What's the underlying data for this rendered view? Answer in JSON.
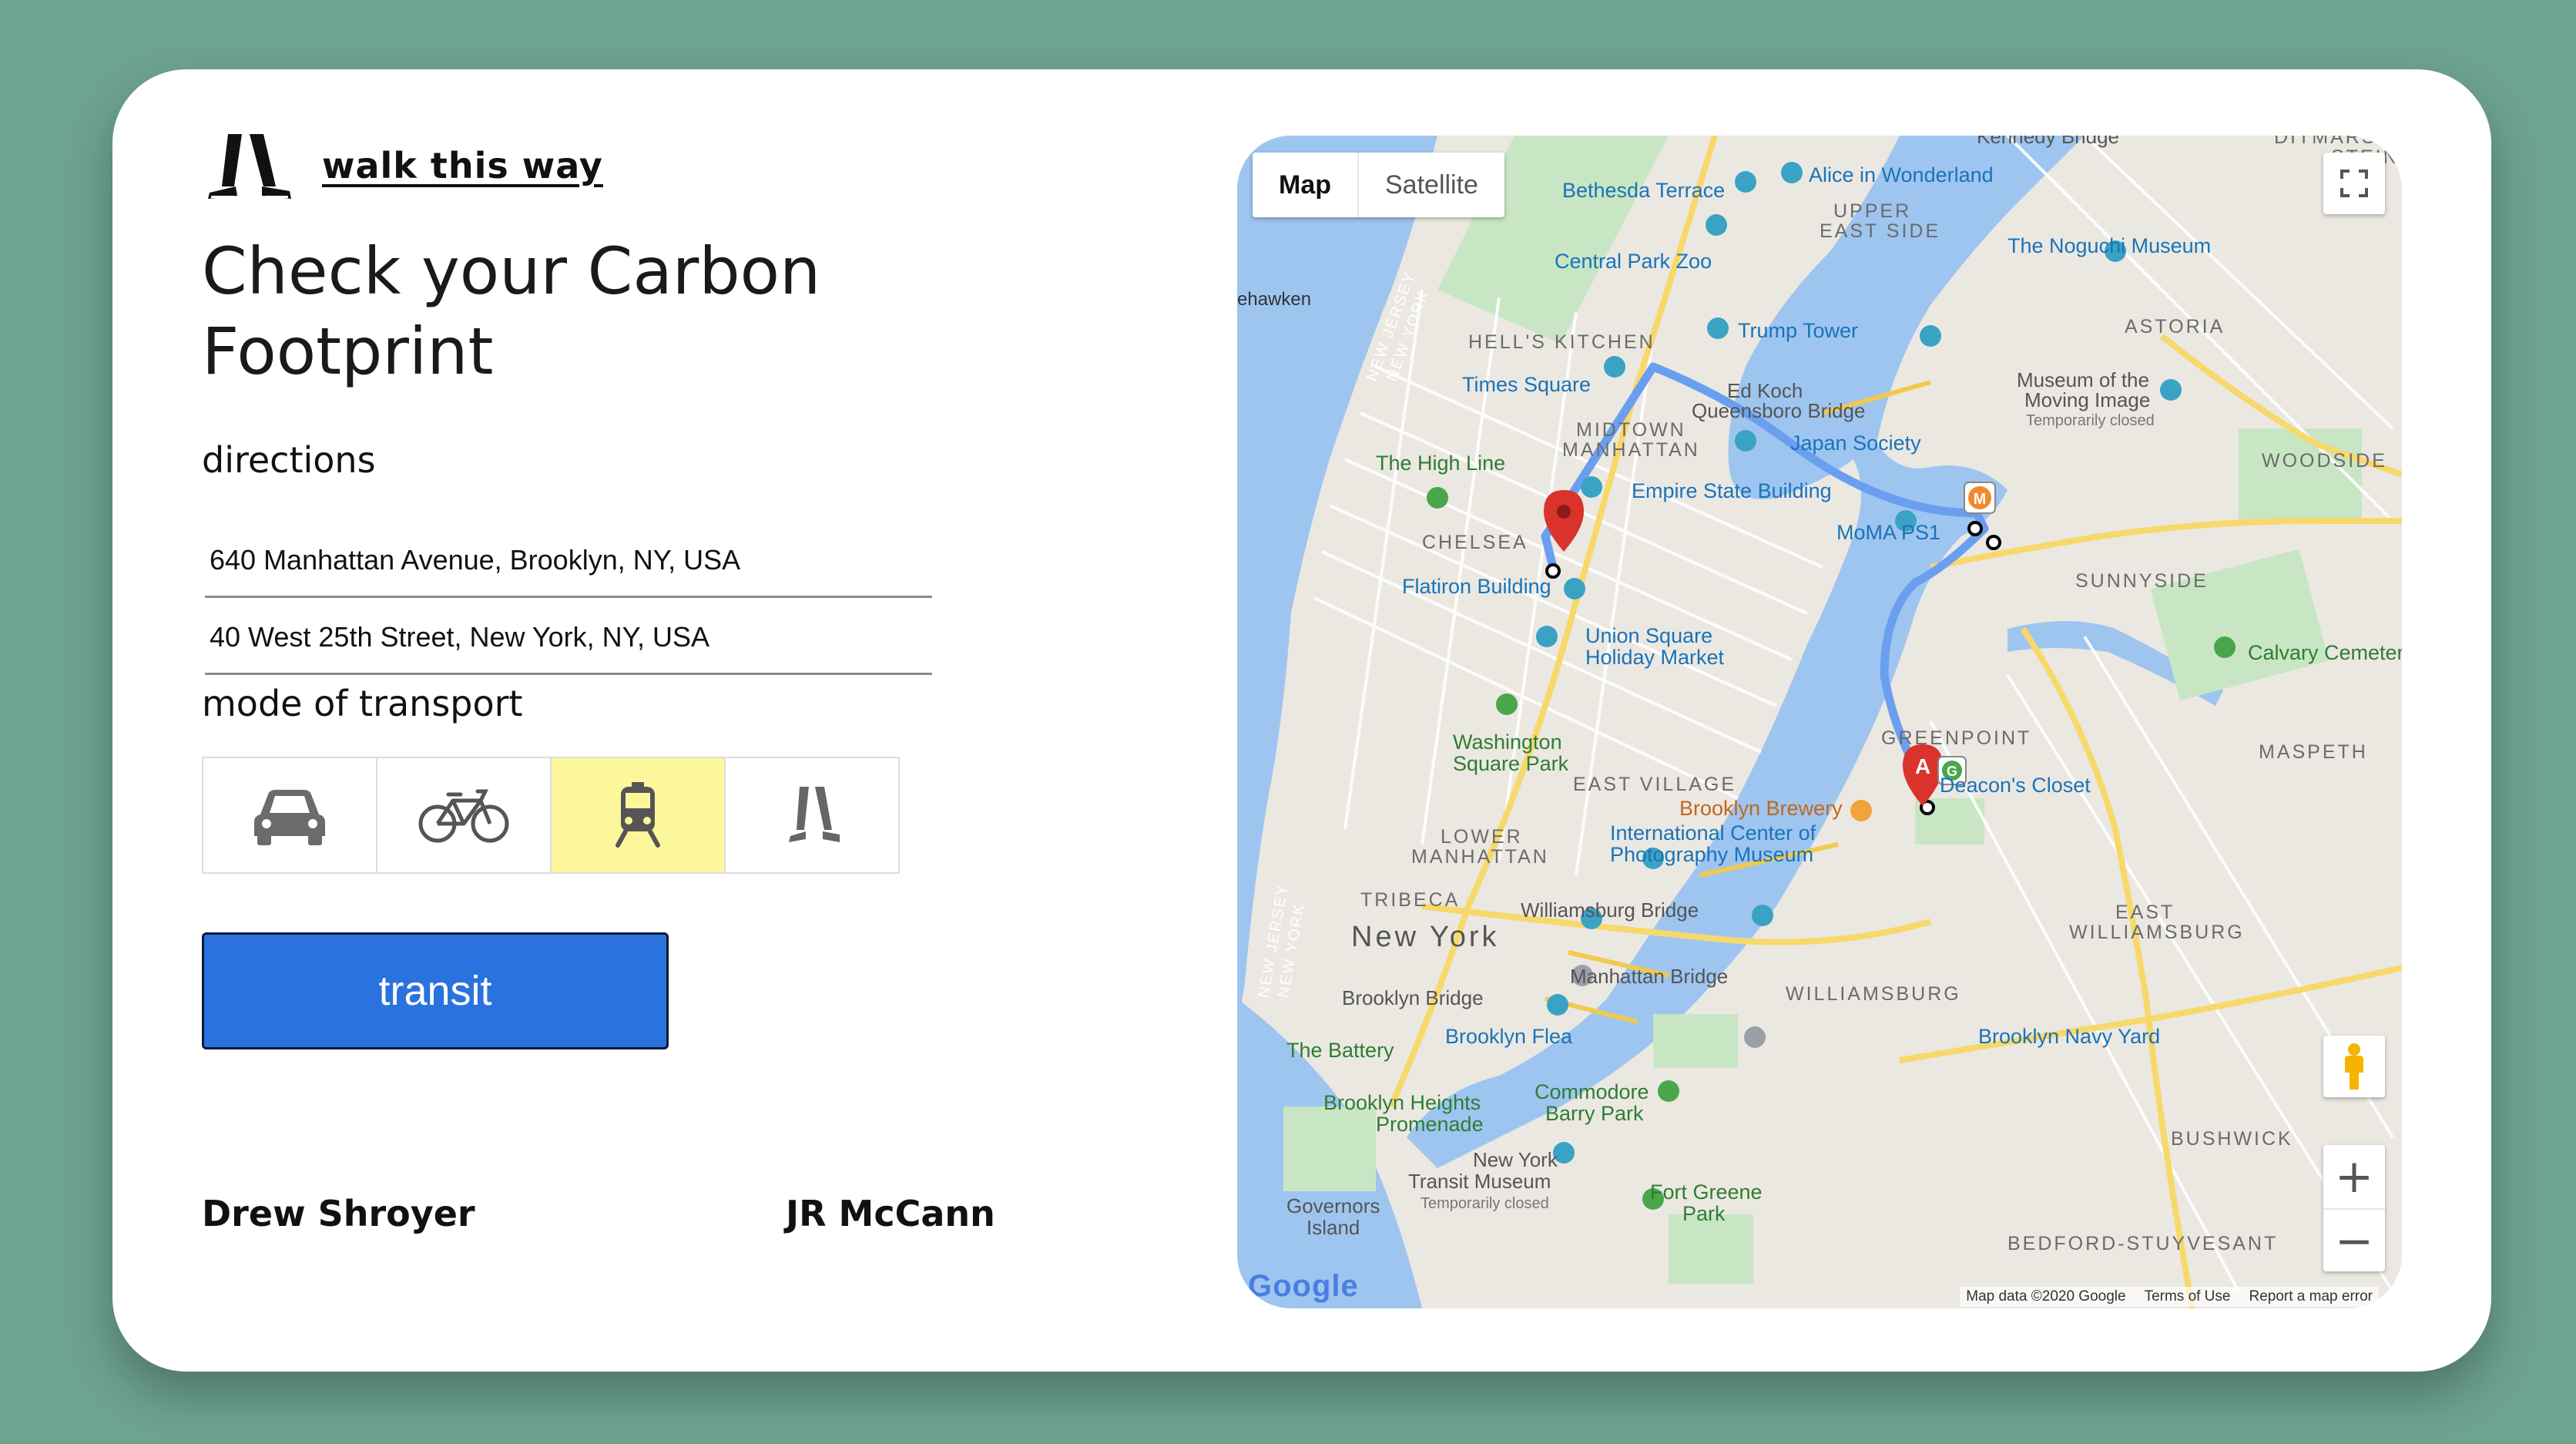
{
  "brand": {
    "name": "walk this way",
    "logo_icon": "walking-legs-icon"
  },
  "page_title": "Check your Carbon Footprint",
  "directions": {
    "label": "directions",
    "origin": "640 Manhattan Avenue, Brooklyn, NY, USA",
    "destination": "40 West 25th Street, New York, NY, USA"
  },
  "transport": {
    "label": "mode of transport",
    "modes": [
      {
        "name": "car",
        "icon": "car-icon",
        "selected": false
      },
      {
        "name": "bike",
        "icon": "bicycle-icon",
        "selected": false
      },
      {
        "name": "transit",
        "icon": "train-icon",
        "selected": true
      },
      {
        "name": "walk",
        "icon": "walking-icon",
        "selected": false
      }
    ],
    "selected_color": "#fdf79c"
  },
  "submit": {
    "label": "transit",
    "color": "#2a72de"
  },
  "authors": [
    "Drew Shroyer",
    "JR McCann"
  ],
  "map": {
    "tabs": {
      "map": "Map",
      "satellite": "Satellite"
    },
    "zoom_in": "+",
    "zoom_out": "−",
    "footer": {
      "data": "Map data ©2020 Google",
      "terms": "Terms of Use",
      "report": "Report a map error"
    },
    "google_logo": "Google",
    "route_color": "#6a9ff0",
    "labels": {
      "kennedy_bridge": "Kennedy Bridge",
      "ditmars": "DITMARS-",
      "steinway": "STEIN",
      "bethesda": "Bethesda Terrace",
      "alice": "Alice in Wonderland",
      "upper_east": "UPPER",
      "upper_east2": "EAST SIDE",
      "noguchi": "The Noguchi Museum",
      "hawken": "ehawken",
      "central_park_zoo": "Central Park Zoo",
      "trump_tower": "Trump Tower",
      "astoria": "ASTORIA",
      "hells_kitchen": "HELL'S KITCHEN",
      "ed_koch": "Ed Koch",
      "queensboro": "Queensboro Bridge",
      "moving_image": "Museum of the",
      "moving_image2": "Moving Image",
      "temp_closed": "Temporarily closed",
      "times_square": "Times Square",
      "midtown": "MIDTOWN",
      "manhattan": "MANHATTAN",
      "japan_society": "Japan Society",
      "woodside": "WOODSIDE",
      "high_line": "The High Line",
      "esb": "Empire State Building",
      "chelsea": "CHELSEA",
      "moma_ps1": "MoMA PS1",
      "flatiron": "Flatiron Building",
      "sunnyside": "SUNNYSIDE",
      "union_square": "Union Square",
      "holiday_market": "Holiday Market",
      "calvary": "Calvary Cemetery",
      "washington_sq": "Washington",
      "washington_sq2": "Square Park",
      "greenpoint": "GREENPOINT",
      "maspeth": "MASPETH",
      "east_village": "EAST VILLAGE",
      "deacons": "Deacon's Closet",
      "brooklyn_brewery": "Brooklyn Brewery",
      "lower": "LOWER",
      "lower2": "MANHATTAN",
      "icp": "International Center of",
      "icp2": "Photography Museum",
      "tribeca": "TRIBECA",
      "williamsburg_bridge": "Williamsburg Bridge",
      "east_williamsburg": "EAST",
      "east_williamsburg2": "WILLIAMSBURG",
      "new_york": "New York",
      "brooklyn_bridge": "Brooklyn Bridge",
      "manhattan_bridge": "Manhattan Bridge",
      "williamsburg": "WILLIAMSBURG",
      "the_battery": "The Battery",
      "brooklyn_flea": "Brooklyn Flea",
      "navy_yard": "Brooklyn Navy Yard",
      "brooklyn_heights": "Brooklyn Heights",
      "promenade": "Promenade",
      "commodore": "Commodore",
      "barry_park": "Barry Park",
      "bushwick": "BUSHWICK",
      "ny_transit": "New York",
      "ny_transit2": "Transit Museum",
      "fort_greene": "Fort Greene",
      "fort_greene2": "Park",
      "governors": "Governors",
      "governors2": "Island",
      "bed_stuy": "BEDFORD-STUYVESANT",
      "new_jersey": "NEW JERSEY",
      "new_york_state": "NEW YORK"
    }
  }
}
